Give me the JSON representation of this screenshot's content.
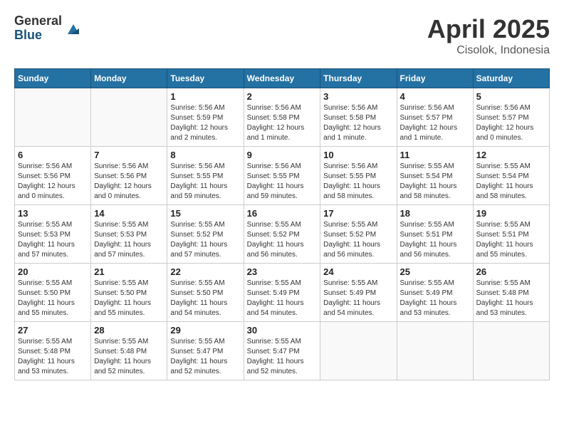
{
  "logo": {
    "general": "General",
    "blue": "Blue"
  },
  "title": "April 2025",
  "location": "Cisolok, Indonesia",
  "weekdays": [
    "Sunday",
    "Monday",
    "Tuesday",
    "Wednesday",
    "Thursday",
    "Friday",
    "Saturday"
  ],
  "weeks": [
    [
      {
        "day": "",
        "info": ""
      },
      {
        "day": "",
        "info": ""
      },
      {
        "day": "1",
        "info": "Sunrise: 5:56 AM\nSunset: 5:59 PM\nDaylight: 12 hours and 2 minutes."
      },
      {
        "day": "2",
        "info": "Sunrise: 5:56 AM\nSunset: 5:58 PM\nDaylight: 12 hours and 1 minute."
      },
      {
        "day": "3",
        "info": "Sunrise: 5:56 AM\nSunset: 5:58 PM\nDaylight: 12 hours and 1 minute."
      },
      {
        "day": "4",
        "info": "Sunrise: 5:56 AM\nSunset: 5:57 PM\nDaylight: 12 hours and 1 minute."
      },
      {
        "day": "5",
        "info": "Sunrise: 5:56 AM\nSunset: 5:57 PM\nDaylight: 12 hours and 0 minutes."
      }
    ],
    [
      {
        "day": "6",
        "info": "Sunrise: 5:56 AM\nSunset: 5:56 PM\nDaylight: 12 hours and 0 minutes."
      },
      {
        "day": "7",
        "info": "Sunrise: 5:56 AM\nSunset: 5:56 PM\nDaylight: 12 hours and 0 minutes."
      },
      {
        "day": "8",
        "info": "Sunrise: 5:56 AM\nSunset: 5:55 PM\nDaylight: 11 hours and 59 minutes."
      },
      {
        "day": "9",
        "info": "Sunrise: 5:56 AM\nSunset: 5:55 PM\nDaylight: 11 hours and 59 minutes."
      },
      {
        "day": "10",
        "info": "Sunrise: 5:56 AM\nSunset: 5:55 PM\nDaylight: 11 hours and 58 minutes."
      },
      {
        "day": "11",
        "info": "Sunrise: 5:55 AM\nSunset: 5:54 PM\nDaylight: 11 hours and 58 minutes."
      },
      {
        "day": "12",
        "info": "Sunrise: 5:55 AM\nSunset: 5:54 PM\nDaylight: 11 hours and 58 minutes."
      }
    ],
    [
      {
        "day": "13",
        "info": "Sunrise: 5:55 AM\nSunset: 5:53 PM\nDaylight: 11 hours and 57 minutes."
      },
      {
        "day": "14",
        "info": "Sunrise: 5:55 AM\nSunset: 5:53 PM\nDaylight: 11 hours and 57 minutes."
      },
      {
        "day": "15",
        "info": "Sunrise: 5:55 AM\nSunset: 5:52 PM\nDaylight: 11 hours and 57 minutes."
      },
      {
        "day": "16",
        "info": "Sunrise: 5:55 AM\nSunset: 5:52 PM\nDaylight: 11 hours and 56 minutes."
      },
      {
        "day": "17",
        "info": "Sunrise: 5:55 AM\nSunset: 5:52 PM\nDaylight: 11 hours and 56 minutes."
      },
      {
        "day": "18",
        "info": "Sunrise: 5:55 AM\nSunset: 5:51 PM\nDaylight: 11 hours and 56 minutes."
      },
      {
        "day": "19",
        "info": "Sunrise: 5:55 AM\nSunset: 5:51 PM\nDaylight: 11 hours and 55 minutes."
      }
    ],
    [
      {
        "day": "20",
        "info": "Sunrise: 5:55 AM\nSunset: 5:50 PM\nDaylight: 11 hours and 55 minutes."
      },
      {
        "day": "21",
        "info": "Sunrise: 5:55 AM\nSunset: 5:50 PM\nDaylight: 11 hours and 55 minutes."
      },
      {
        "day": "22",
        "info": "Sunrise: 5:55 AM\nSunset: 5:50 PM\nDaylight: 11 hours and 54 minutes."
      },
      {
        "day": "23",
        "info": "Sunrise: 5:55 AM\nSunset: 5:49 PM\nDaylight: 11 hours and 54 minutes."
      },
      {
        "day": "24",
        "info": "Sunrise: 5:55 AM\nSunset: 5:49 PM\nDaylight: 11 hours and 54 minutes."
      },
      {
        "day": "25",
        "info": "Sunrise: 5:55 AM\nSunset: 5:49 PM\nDaylight: 11 hours and 53 minutes."
      },
      {
        "day": "26",
        "info": "Sunrise: 5:55 AM\nSunset: 5:48 PM\nDaylight: 11 hours and 53 minutes."
      }
    ],
    [
      {
        "day": "27",
        "info": "Sunrise: 5:55 AM\nSunset: 5:48 PM\nDaylight: 11 hours and 53 minutes."
      },
      {
        "day": "28",
        "info": "Sunrise: 5:55 AM\nSunset: 5:48 PM\nDaylight: 11 hours and 52 minutes."
      },
      {
        "day": "29",
        "info": "Sunrise: 5:55 AM\nSunset: 5:47 PM\nDaylight: 11 hours and 52 minutes."
      },
      {
        "day": "30",
        "info": "Sunrise: 5:55 AM\nSunset: 5:47 PM\nDaylight: 11 hours and 52 minutes."
      },
      {
        "day": "",
        "info": ""
      },
      {
        "day": "",
        "info": ""
      },
      {
        "day": "",
        "info": ""
      }
    ]
  ]
}
